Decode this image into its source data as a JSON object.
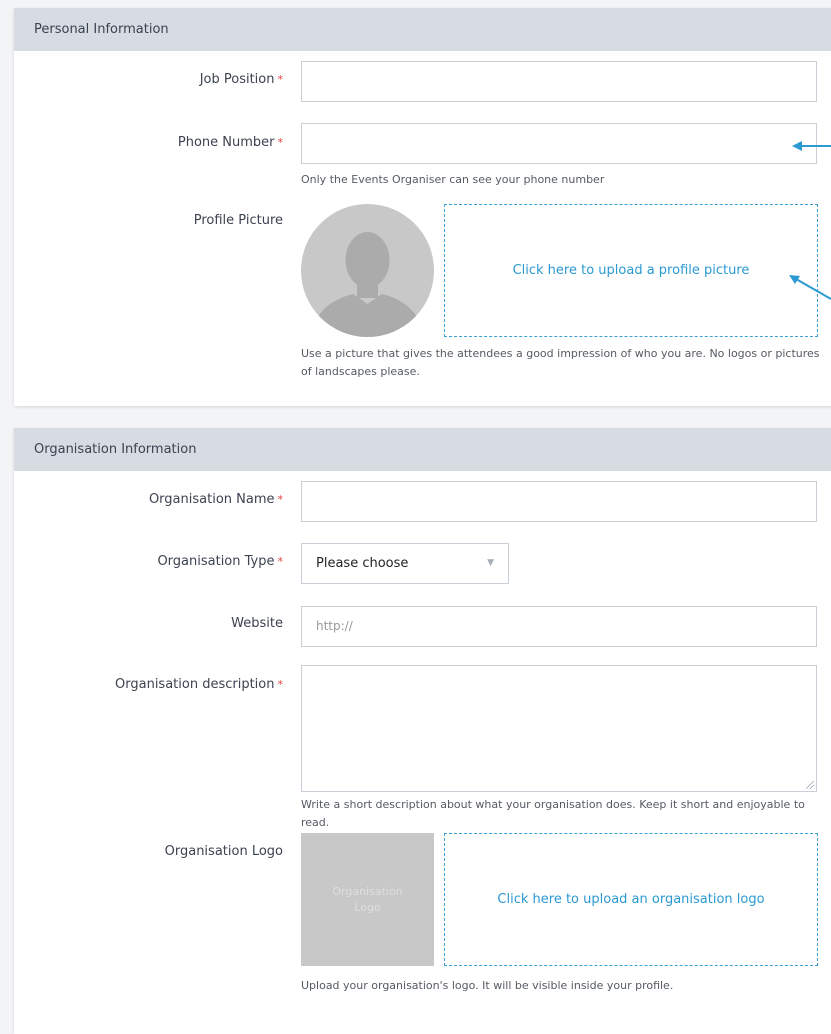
{
  "personal": {
    "title": "Personal Information",
    "job_position_label": "Job Position",
    "phone_label": "Phone Number",
    "phone_help": "Only the Events Organiser can see your phone number",
    "profile_picture_label": "Profile Picture",
    "upload_picture_text": "Click here to upload a profile picture",
    "picture_help": "Use a picture that gives the attendees a good impression of who you are. No logos or pictures of landscapes please."
  },
  "organisation": {
    "title": "Organisation Information",
    "name_label": "Organisation Name",
    "type_label": "Organisation Type",
    "type_selected": "Please choose",
    "website_label": "Website",
    "website_placeholder": "http://",
    "description_label": "Organisation description",
    "description_help": "Write a short description about what your organisation does. Keep it short and enjoyable to read.",
    "logo_label": "Organisation Logo",
    "logo_placeholder": "Organisation Logo",
    "upload_logo_text": "Click here to upload an organisation logo",
    "logo_help": "Upload your organisation's logo. It will be visible inside your profile."
  },
  "required_marker": "*",
  "colors": {
    "accent": "#2b9ad3",
    "required": "#e2413c",
    "header_bg": "#d6dce2"
  },
  "icons": {
    "avatar": "person-silhouette-icon",
    "dropdown": "triangle-down-icon",
    "annotation": "arrow-icon"
  }
}
